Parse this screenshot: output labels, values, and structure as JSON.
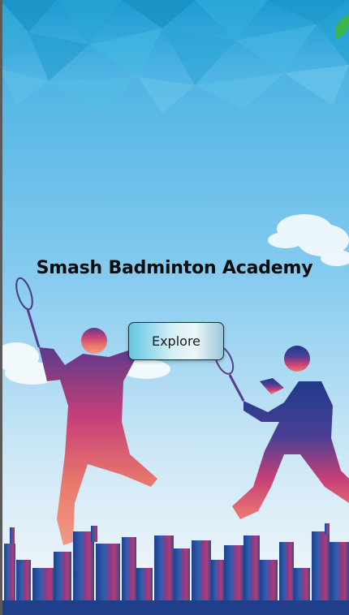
{
  "app": {
    "title": "Smash Badminton Academy",
    "explore_label": "Explore"
  },
  "background": {
    "sky_top": "#1c9bd0",
    "sky_mid": "#7cc9ee",
    "sky_bottom": "#f4f8fb",
    "accent_green": "#3db54a",
    "player_gradient": [
      "#6a3a8e",
      "#c63f78",
      "#ee7a6a"
    ],
    "city_colors": [
      "#1f3f8a",
      "#2e5fb0",
      "#b03c73",
      "#7a3a8e"
    ]
  }
}
